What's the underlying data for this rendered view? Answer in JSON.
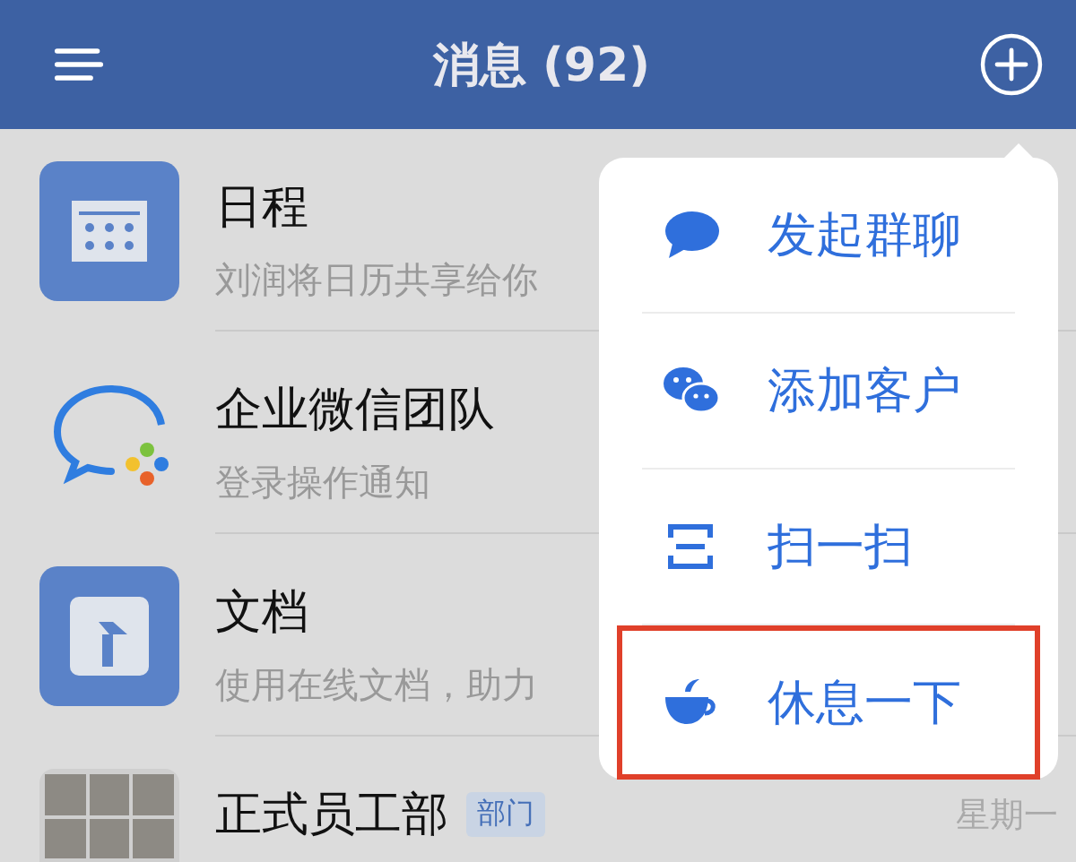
{
  "header": {
    "title": "消息 (92)"
  },
  "conversations": [
    {
      "kind": "calendar",
      "name": "日程",
      "preview": "刘润将日历共享给你"
    },
    {
      "kind": "logo",
      "name": "企业微信团队",
      "preview": "登录操作通知"
    },
    {
      "kind": "doc",
      "name": "文档",
      "preview": "使用在线文档，助力"
    },
    {
      "kind": "group",
      "name": "正式员工部",
      "tag": "部门",
      "time": "星期一"
    }
  ],
  "menu": [
    {
      "kind": "chat",
      "label": "发起群聊",
      "highlighted": false
    },
    {
      "kind": "wechat",
      "label": "添加客户",
      "highlighted": false
    },
    {
      "kind": "scan",
      "label": "扫一扫",
      "highlighted": false
    },
    {
      "kind": "cup",
      "label": "休息一下",
      "highlighted": true
    }
  ]
}
